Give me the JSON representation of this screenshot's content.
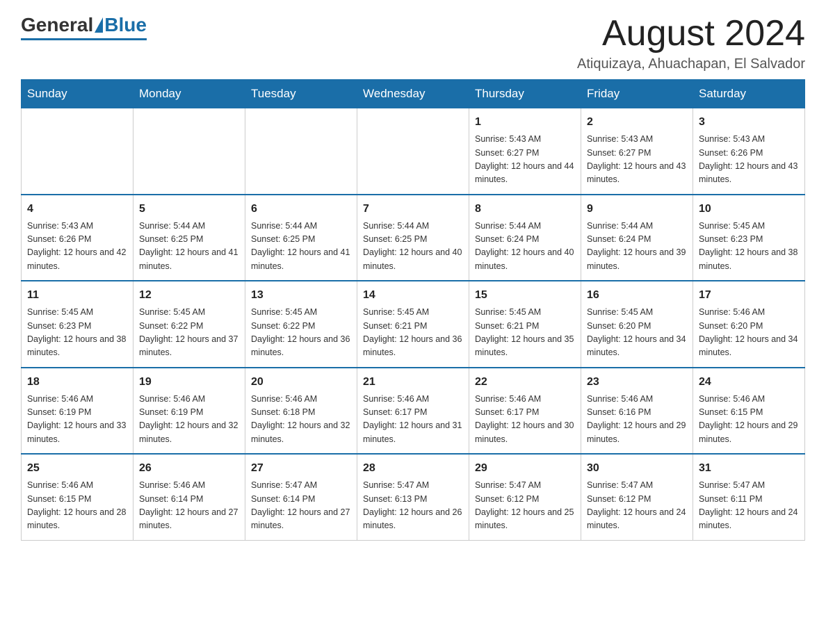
{
  "logo": {
    "general": "General",
    "blue": "Blue"
  },
  "header": {
    "month_title": "August 2024",
    "location": "Atiquizaya, Ahuachapan, El Salvador"
  },
  "days_of_week": [
    "Sunday",
    "Monday",
    "Tuesday",
    "Wednesday",
    "Thursday",
    "Friday",
    "Saturday"
  ],
  "weeks": [
    [
      {
        "day": "",
        "info": ""
      },
      {
        "day": "",
        "info": ""
      },
      {
        "day": "",
        "info": ""
      },
      {
        "day": "",
        "info": ""
      },
      {
        "day": "1",
        "info": "Sunrise: 5:43 AM\nSunset: 6:27 PM\nDaylight: 12 hours and 44 minutes."
      },
      {
        "day": "2",
        "info": "Sunrise: 5:43 AM\nSunset: 6:27 PM\nDaylight: 12 hours and 43 minutes."
      },
      {
        "day": "3",
        "info": "Sunrise: 5:43 AM\nSunset: 6:26 PM\nDaylight: 12 hours and 43 minutes."
      }
    ],
    [
      {
        "day": "4",
        "info": "Sunrise: 5:43 AM\nSunset: 6:26 PM\nDaylight: 12 hours and 42 minutes."
      },
      {
        "day": "5",
        "info": "Sunrise: 5:44 AM\nSunset: 6:25 PM\nDaylight: 12 hours and 41 minutes."
      },
      {
        "day": "6",
        "info": "Sunrise: 5:44 AM\nSunset: 6:25 PM\nDaylight: 12 hours and 41 minutes."
      },
      {
        "day": "7",
        "info": "Sunrise: 5:44 AM\nSunset: 6:25 PM\nDaylight: 12 hours and 40 minutes."
      },
      {
        "day": "8",
        "info": "Sunrise: 5:44 AM\nSunset: 6:24 PM\nDaylight: 12 hours and 40 minutes."
      },
      {
        "day": "9",
        "info": "Sunrise: 5:44 AM\nSunset: 6:24 PM\nDaylight: 12 hours and 39 minutes."
      },
      {
        "day": "10",
        "info": "Sunrise: 5:45 AM\nSunset: 6:23 PM\nDaylight: 12 hours and 38 minutes."
      }
    ],
    [
      {
        "day": "11",
        "info": "Sunrise: 5:45 AM\nSunset: 6:23 PM\nDaylight: 12 hours and 38 minutes."
      },
      {
        "day": "12",
        "info": "Sunrise: 5:45 AM\nSunset: 6:22 PM\nDaylight: 12 hours and 37 minutes."
      },
      {
        "day": "13",
        "info": "Sunrise: 5:45 AM\nSunset: 6:22 PM\nDaylight: 12 hours and 36 minutes."
      },
      {
        "day": "14",
        "info": "Sunrise: 5:45 AM\nSunset: 6:21 PM\nDaylight: 12 hours and 36 minutes."
      },
      {
        "day": "15",
        "info": "Sunrise: 5:45 AM\nSunset: 6:21 PM\nDaylight: 12 hours and 35 minutes."
      },
      {
        "day": "16",
        "info": "Sunrise: 5:45 AM\nSunset: 6:20 PM\nDaylight: 12 hours and 34 minutes."
      },
      {
        "day": "17",
        "info": "Sunrise: 5:46 AM\nSunset: 6:20 PM\nDaylight: 12 hours and 34 minutes."
      }
    ],
    [
      {
        "day": "18",
        "info": "Sunrise: 5:46 AM\nSunset: 6:19 PM\nDaylight: 12 hours and 33 minutes."
      },
      {
        "day": "19",
        "info": "Sunrise: 5:46 AM\nSunset: 6:19 PM\nDaylight: 12 hours and 32 minutes."
      },
      {
        "day": "20",
        "info": "Sunrise: 5:46 AM\nSunset: 6:18 PM\nDaylight: 12 hours and 32 minutes."
      },
      {
        "day": "21",
        "info": "Sunrise: 5:46 AM\nSunset: 6:17 PM\nDaylight: 12 hours and 31 minutes."
      },
      {
        "day": "22",
        "info": "Sunrise: 5:46 AM\nSunset: 6:17 PM\nDaylight: 12 hours and 30 minutes."
      },
      {
        "day": "23",
        "info": "Sunrise: 5:46 AM\nSunset: 6:16 PM\nDaylight: 12 hours and 29 minutes."
      },
      {
        "day": "24",
        "info": "Sunrise: 5:46 AM\nSunset: 6:15 PM\nDaylight: 12 hours and 29 minutes."
      }
    ],
    [
      {
        "day": "25",
        "info": "Sunrise: 5:46 AM\nSunset: 6:15 PM\nDaylight: 12 hours and 28 minutes."
      },
      {
        "day": "26",
        "info": "Sunrise: 5:46 AM\nSunset: 6:14 PM\nDaylight: 12 hours and 27 minutes."
      },
      {
        "day": "27",
        "info": "Sunrise: 5:47 AM\nSunset: 6:14 PM\nDaylight: 12 hours and 27 minutes."
      },
      {
        "day": "28",
        "info": "Sunrise: 5:47 AM\nSunset: 6:13 PM\nDaylight: 12 hours and 26 minutes."
      },
      {
        "day": "29",
        "info": "Sunrise: 5:47 AM\nSunset: 6:12 PM\nDaylight: 12 hours and 25 minutes."
      },
      {
        "day": "30",
        "info": "Sunrise: 5:47 AM\nSunset: 6:12 PM\nDaylight: 12 hours and 24 minutes."
      },
      {
        "day": "31",
        "info": "Sunrise: 5:47 AM\nSunset: 6:11 PM\nDaylight: 12 hours and 24 minutes."
      }
    ]
  ]
}
